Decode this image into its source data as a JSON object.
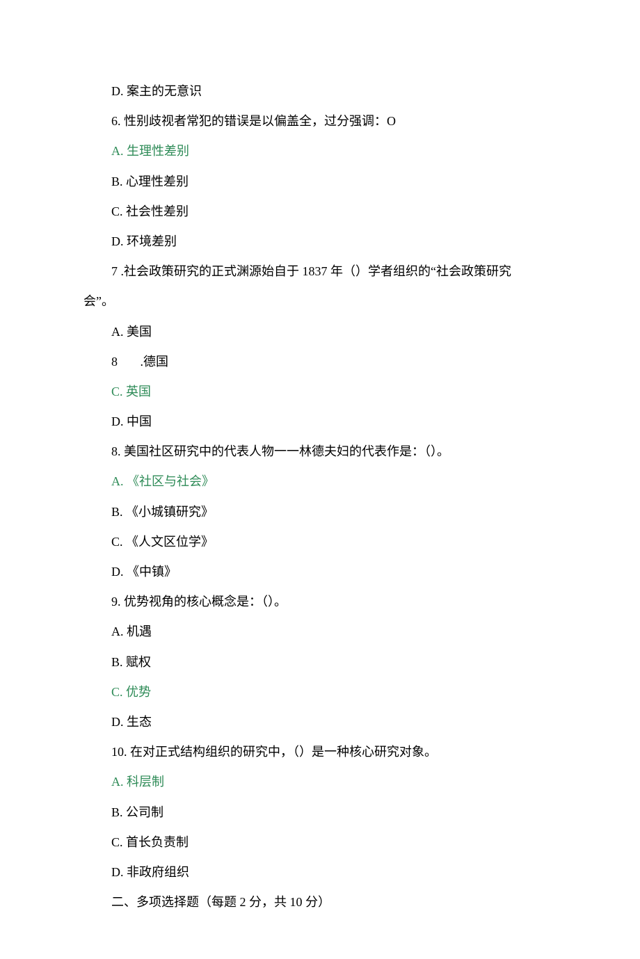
{
  "lines": {
    "l5d": "D. 案主的无意识",
    "q6": "6. 性别歧视者常犯的错误是以偏盖全，过分强调：O",
    "q6a": "A. 生理性差别",
    "q6b": "B. 心理性差别",
    "q6c": "C. 社会性差别",
    "q6d": "D. 环境差别",
    "q7a_prefix": "7  .社会政策研究的正式渊源始自于 1837 年（）学者组织的“社会政策研究",
    "q7a_suffix": "会”。",
    "q7_a": "A. 美国",
    "q7_b_num": "8",
    "q7_b_txt": ".德国",
    "q7_c": "C. 英国",
    "q7_d": "D. 中国",
    "q8": "8. 美国社区研究中的代表人物一一林德夫妇的代表作是：（）。",
    "q8a": "A. 《社区与社会》",
    "q8b": "B. 《小城镇研究》",
    "q8c": "C. 《人文区位学》",
    "q8d": "D. 《中镇》",
    "q9": "9. 优势视角的核心概念是：（）。",
    "q9a": "A. 机遇",
    "q9b": "B. 赋权",
    "q9c": "C. 优势",
    "q9d": "D. 生态",
    "q10": "10. 在对正式结构组织的研究中，（）是一种核心研究对象。",
    "q10a": "A. 科层制",
    "q10b": "B. 公司制",
    "q10c": "C. 首长负责制",
    "q10d": "D. 非政府组织",
    "section2": "二、多项选择题（每题 2 分，共 10 分）"
  }
}
